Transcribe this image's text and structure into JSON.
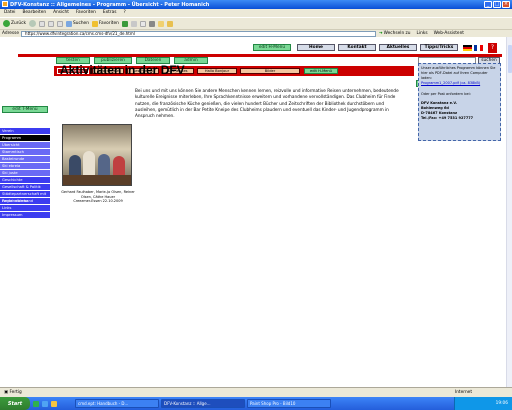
{
  "window": {
    "title": "DFV-Konstanz :: Allgemeines - Programm - Übersicht - Peter Homanich"
  },
  "menu": [
    "Datei",
    "Bearbeiten",
    "Ansicht",
    "Favoriten",
    "Extras",
    "?"
  ],
  "toolbar": {
    "back": "Zurück",
    "search": "Suchen",
    "favorites": "Favoriten"
  },
  "address": {
    "label": "Adresse",
    "url": "https://www.dfvintegration.ca/cms.cms-dfv/21_de.html",
    "go": "Wechseln zu",
    "links": "Links",
    "assistant": "Web-Assistent"
  },
  "site": {
    "topnav": [
      "edit H-Menü",
      "Home",
      "Kontakt",
      "Aktuelles",
      "Tipps/Tricks"
    ],
    "tabs": [
      "testen",
      "publizieren",
      "Dateien",
      "admin"
    ],
    "search_button": "suchen",
    "subnav": [
      "Allgemeines",
      "Sprachkurse",
      "Les Primus",
      "Les Jeunes",
      "Hallo Bonjour",
      "Bilder",
      "edit H-Menü"
    ],
    "edit_text": "edit Text",
    "move_btn": "verschieben",
    "edit_tmenu": "edit T-Menü",
    "left_nav": [
      {
        "label": "Verein",
        "style": "main"
      },
      {
        "label": "Programm",
        "style": "black"
      },
      {
        "label": "Übersicht",
        "style": "sub"
      },
      {
        "label": "Stammtisch",
        "style": "sub"
      },
      {
        "label": "Bastelrunde",
        "style": "sub"
      },
      {
        "label": "Ski ebreia",
        "style": "sub"
      },
      {
        "label": "Ski juste",
        "style": "sub"
      },
      {
        "label": "Geschichte",
        "style": "main"
      },
      {
        "label": "Gesellschaft & Politik",
        "style": "main"
      },
      {
        "label": "Städtepartnerschaft mit Fontainebleau",
        "style": "main"
      },
      {
        "label": "Regionalverband",
        "style": "main"
      },
      {
        "label": "Links",
        "style": "main"
      },
      {
        "label": "Impressum",
        "style": "main"
      }
    ],
    "heading": "Aktivitäten in der DFV",
    "photo_caption": "Gerhard Faulhaber, Marie-Jo Olsen, Reiner Olsen, Cäthe Hauer\nCreezmer-Essen 22.10.2009",
    "body_text": "Bei uns und mit uns können Sie andere Menschen kennen lernen, reizvolle und informative Reisen unternehmen, bedeutende kulturelle Ereignisse miterleben, Ihre Sprachkenntnisse erweitern und vorhandene vervollständigen. Das Clubheim für Finde nutzen, die französische Küche genießen, die vielen hundert Bücher und Zeitschriften der Bibliothek durchstöbern und ausleihen, gemütlich in der Bar Petite Kneipe des Clubheims plaudern und eventuell das Kinder- und Jugendprogramm in Anspruch nehmen.",
    "sidebar_box": {
      "lines": [
        "Unser ausführliches Programm können Sie hier als PDF-Datei auf Ihren Computer laden:"
      ],
      "link": "Programm1_2007.pdf (ca. 838kB)",
      "order": "Oder per Post anfordern bei:",
      "address": [
        "DFV Konstanz e.V.",
        "Bohlenweg 6d",
        "D-78467 Konstanz",
        "Tel./Fax: +49 7531 927777"
      ]
    }
  },
  "status": {
    "left": "Fertig",
    "right": "Internet"
  },
  "taskbar": {
    "start": "Start",
    "tasks": [
      "cmd.ept: Handbuch - D...",
      "DFV-Konstanz :: Allge...",
      "Paint Shop Pro - Bild10"
    ],
    "clock": "19:06"
  }
}
